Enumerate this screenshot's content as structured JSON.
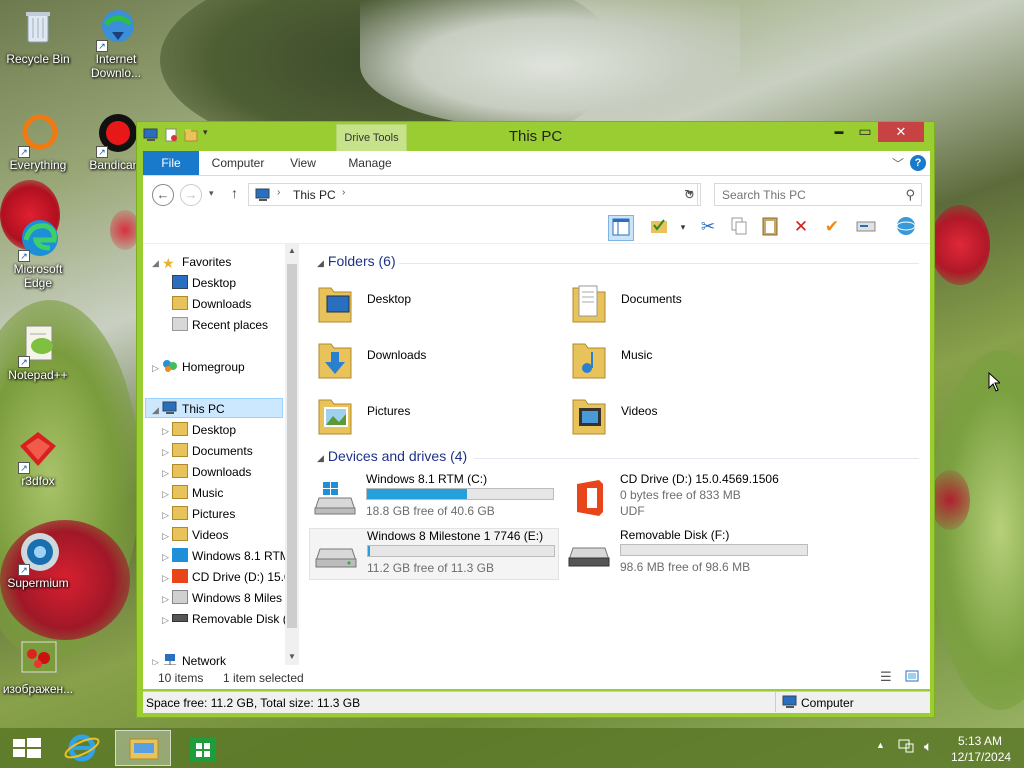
{
  "desktop": {
    "icons": [
      {
        "label": "Recycle Bin"
      },
      {
        "label": "Internet Downlo..."
      },
      {
        "label": "Everything"
      },
      {
        "label": "Bandicam"
      },
      {
        "label": "Microsoft Edge"
      },
      {
        "label": "Notepad++"
      },
      {
        "label": "r3dfox"
      },
      {
        "label": "Supermium"
      },
      {
        "label": "изображен..."
      }
    ]
  },
  "window": {
    "title": "This PC",
    "context_tab": "Drive Tools",
    "controls": {
      "minimize": "▬",
      "maximize": "▭",
      "close": "✕"
    },
    "ribbon_tabs": [
      "File",
      "Computer",
      "View",
      "Manage"
    ],
    "address": {
      "path": "This PC",
      "search_placeholder": "Search This PC"
    },
    "nav": {
      "favorites": "Favorites",
      "fav_items": [
        "Desktop",
        "Downloads",
        "Recent places"
      ],
      "homegroup": "Homegroup",
      "thispc": "This PC",
      "pc_items": [
        "Desktop",
        "Documents",
        "Downloads",
        "Music",
        "Pictures",
        "Videos",
        "Windows 8.1 RTM",
        "CD Drive (D:) 15.0",
        "Windows 8 Miles",
        "Removable Disk ("
      ],
      "network": "Network"
    },
    "folders_header": "Folders (6)",
    "folders": [
      "Desktop",
      "Documents",
      "Downloads",
      "Music",
      "Pictures",
      "Videos"
    ],
    "drives_header": "Devices and drives (4)",
    "drives": [
      {
        "name": "Windows 8.1 RTM (C:)",
        "free": "18.8 GB free of 40.6 GB",
        "used_fraction": 0.54
      },
      {
        "name": "CD Drive (D:) 15.0.4569.1506",
        "free": "0 bytes free of 833 MB",
        "fs": "UDF"
      },
      {
        "name": "Windows 8 Milestone 1 7746 (E:)",
        "free": "11.2 GB free of 11.3 GB",
        "used_fraction": 0.01
      },
      {
        "name": "Removable Disk (F:)",
        "free": "98.6 MB free of 98.6 MB",
        "used_fraction": 0.0
      }
    ],
    "status": {
      "items": "10 items",
      "selected": "1 item selected",
      "space": "Space free: 11.2 GB, Total size: 11.3 GB",
      "location": "Computer"
    }
  },
  "taskbar": {
    "time": "5:13 AM",
    "date": "12/17/2024"
  }
}
